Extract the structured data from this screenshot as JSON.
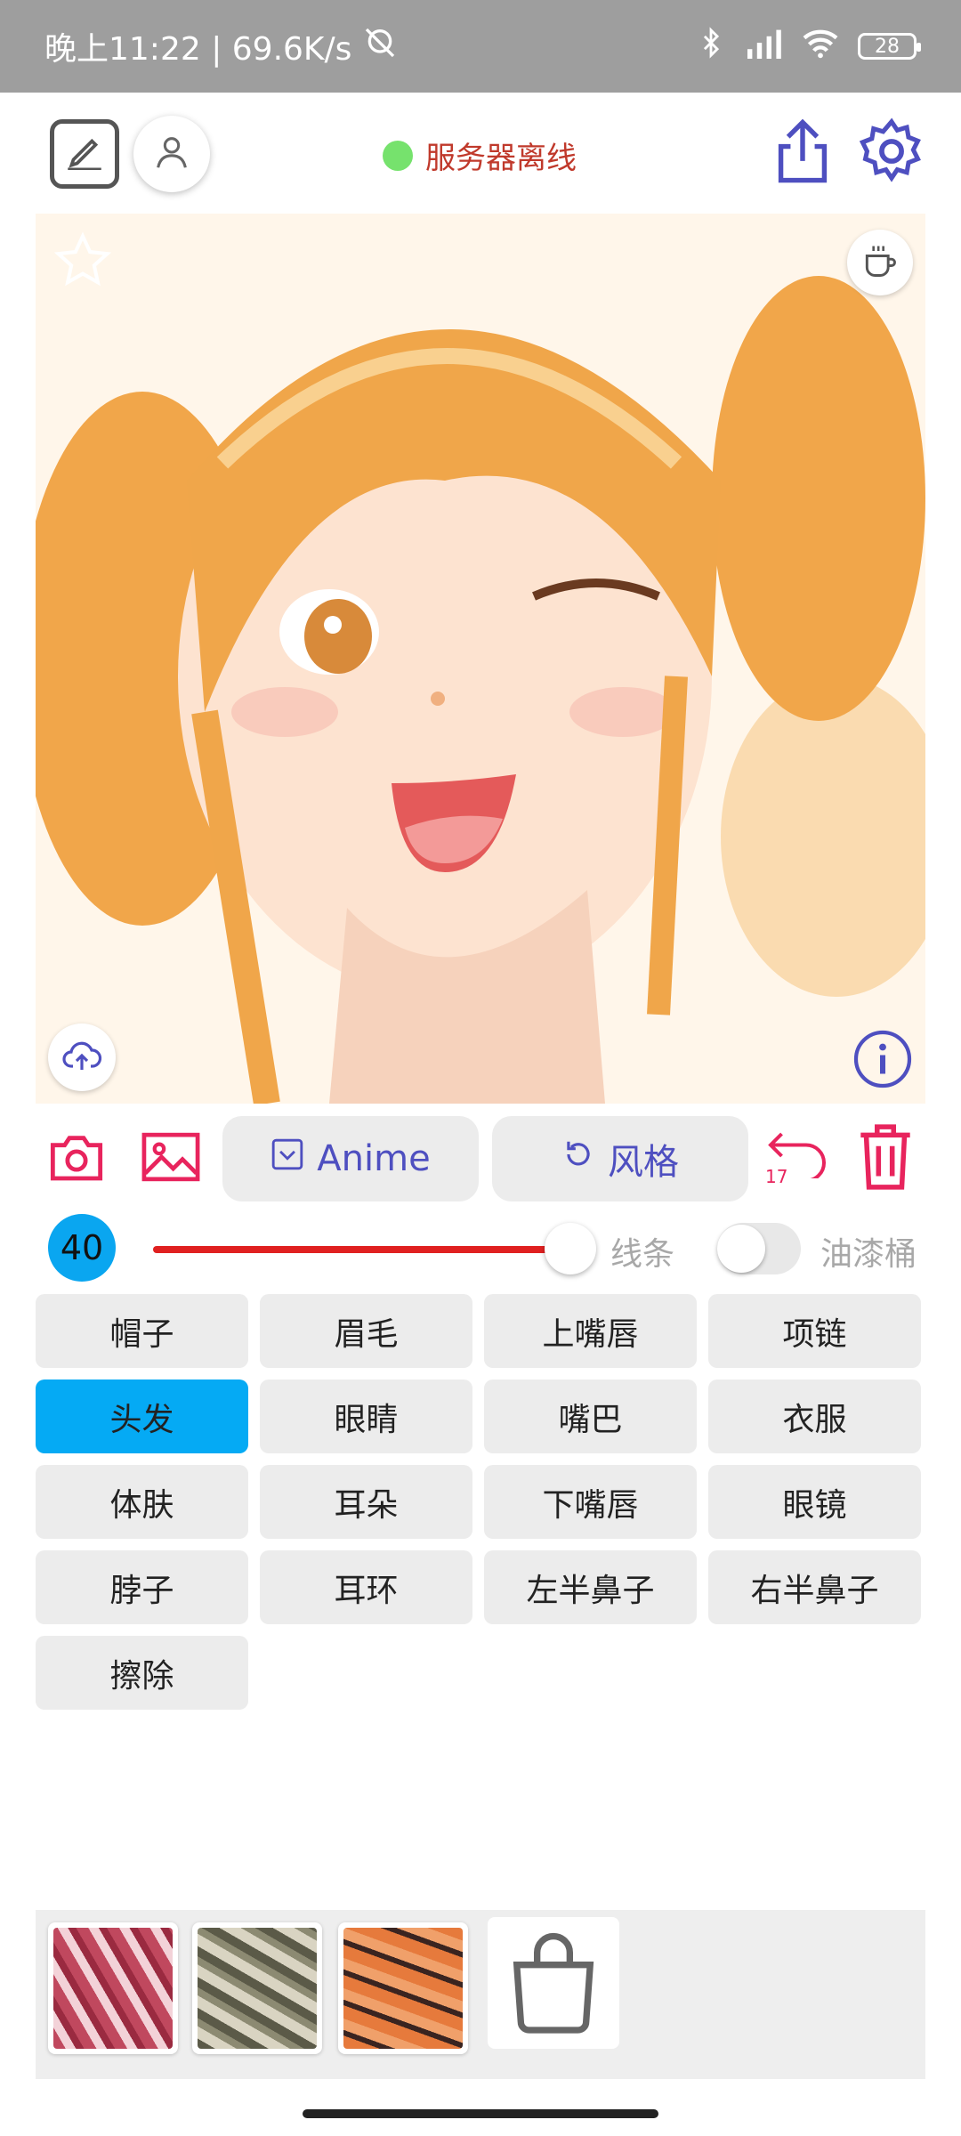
{
  "status_bar": {
    "time_speed": "晚上11:22 | 69.6K/s",
    "battery": "28"
  },
  "top_bar": {
    "server_status": "服务器离线",
    "status_color": "#76e26d"
  },
  "actions": {
    "anime_label": "Anime",
    "style_label": "风格",
    "undo_count": "17"
  },
  "brush": {
    "size": "40",
    "line_label": "线条",
    "bucket_label": "油漆桶",
    "slider_color": "#e02020"
  },
  "labels": [
    {
      "text": "帽子",
      "active": false
    },
    {
      "text": "眉毛",
      "active": false
    },
    {
      "text": "上嘴唇",
      "active": false
    },
    {
      "text": "项链",
      "active": false
    },
    {
      "text": "头发",
      "active": true
    },
    {
      "text": "眼睛",
      "active": false
    },
    {
      "text": "嘴巴",
      "active": false
    },
    {
      "text": "衣服",
      "active": false
    },
    {
      "text": "体肤",
      "active": false
    },
    {
      "text": "耳朵",
      "active": false
    },
    {
      "text": "下嘴唇",
      "active": false
    },
    {
      "text": "眼镜",
      "active": false
    },
    {
      "text": "脖子",
      "active": false
    },
    {
      "text": "耳环",
      "active": false
    },
    {
      "text": "左半鼻子",
      "active": false
    },
    {
      "text": "右半鼻子",
      "active": false
    },
    {
      "text": "擦除",
      "active": false
    }
  ],
  "colors": {
    "accent": "#4e4fc0",
    "danger": "#e8245d",
    "selected": "#05aaf4"
  },
  "icons": [
    "edit-icon",
    "user-icon",
    "share-icon",
    "settings-icon",
    "star-icon",
    "coffee-icon",
    "upload-cloud-icon",
    "info-icon",
    "camera-icon",
    "image-icon",
    "undo-icon",
    "trash-icon",
    "shopping-bag-icon"
  ]
}
